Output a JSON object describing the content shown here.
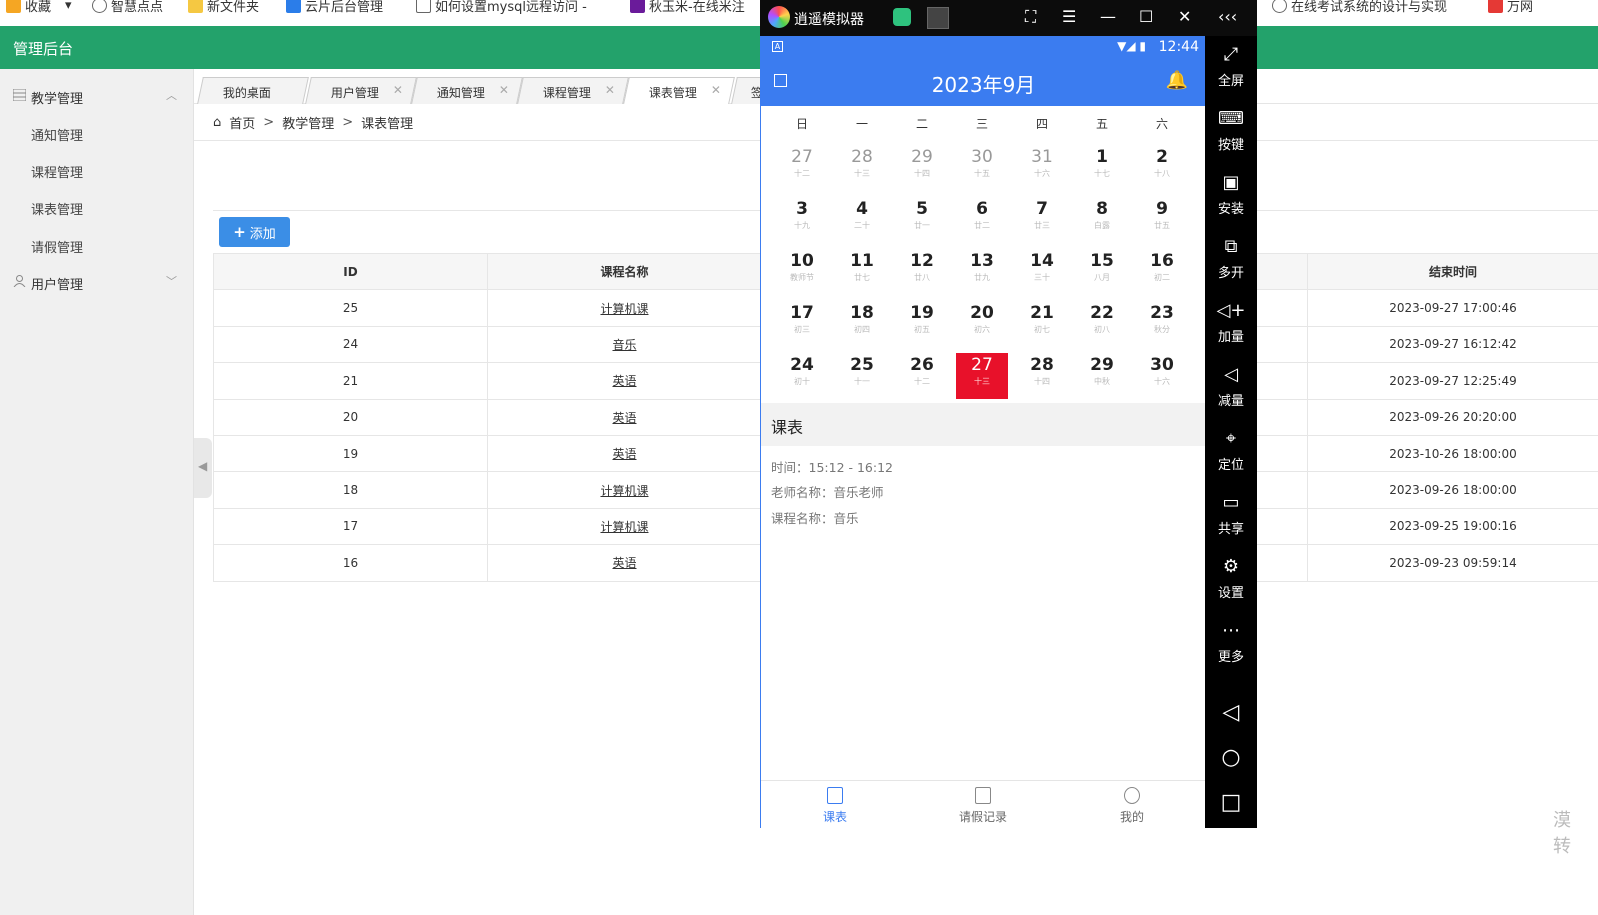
{
  "bookmarks": [
    {
      "label": "收藏",
      "color": "#f5a623"
    },
    {
      "label": "智慧点点",
      "color": "#555555"
    },
    {
      "label": "新文件夹",
      "color": "#f5c842"
    },
    {
      "label": "云片后台管理",
      "color": "#2b7de9"
    },
    {
      "label": "如何设置mysql远程访问 -",
      "color": "#555555"
    },
    {
      "label": "秋玉米-在线米注",
      "color": "#6a1b9a"
    },
    {
      "label": "在线考试系统的设计与实现",
      "color": "#555555"
    },
    {
      "label": "万网",
      "color": "#e53935"
    }
  ],
  "header": {
    "title": "管理后台",
    "accent": "#23a26b"
  },
  "sidebar": {
    "groups": [
      {
        "label": "教学管理",
        "icon": "grid-icon",
        "chevron": "︿"
      },
      {
        "label": "用户管理",
        "icon": "user-icon",
        "chevron": "﹀"
      }
    ],
    "items": [
      {
        "label": "通知管理"
      },
      {
        "label": "课程管理"
      },
      {
        "label": "课表管理"
      },
      {
        "label": "请假管理"
      }
    ]
  },
  "tabs": [
    {
      "label": "我的桌面",
      "closable": false
    },
    {
      "label": "用户管理",
      "closable": true
    },
    {
      "label": "通知管理",
      "closable": true
    },
    {
      "label": "课程管理",
      "closable": true
    },
    {
      "label": "课表管理",
      "closable": true,
      "active": true
    },
    {
      "label": "签",
      "closable": false
    }
  ],
  "breadcrumb": {
    "home": "首页",
    "sep": ">",
    "level1": "教学管理",
    "level2": "课表管理"
  },
  "toolbar": {
    "add_label": "添加"
  },
  "table": {
    "headers": {
      "id": "ID",
      "course": "课程名称",
      "end": "结束时间"
    },
    "rows": [
      {
        "id": "25",
        "course": "计算机课",
        "end": "2023-09-27 17:00:46"
      },
      {
        "id": "24",
        "course": "音乐",
        "end": "2023-09-27 16:12:42"
      },
      {
        "id": "21",
        "course": "英语",
        "end": "2023-09-27 12:25:49"
      },
      {
        "id": "20",
        "course": "英语",
        "end": "2023-09-26 20:20:00"
      },
      {
        "id": "19",
        "course": "英语",
        "end": "2023-10-26 18:00:00"
      },
      {
        "id": "18",
        "course": "计算机课",
        "end": "2023-09-26 18:00:00"
      },
      {
        "id": "17",
        "course": "计算机课",
        "end": "2023-09-25 19:00:16"
      },
      {
        "id": "16",
        "course": "英语",
        "end": "2023-09-23 09:59:14"
      }
    ]
  },
  "emulator": {
    "name": "逍遥模拟器",
    "controls": [
      "⛶",
      "☰",
      "—",
      "☐",
      "✕"
    ],
    "collapse": "‹‹‹",
    "status": {
      "time": "12:44",
      "signal": "▼◢ ▮"
    },
    "app": {
      "title": "2023年9月",
      "bell": "🔔"
    },
    "weekdays": [
      "日",
      "一",
      "二",
      "三",
      "四",
      "五",
      "六"
    ],
    "days": [
      {
        "n": "27",
        "l": "十二",
        "other": true
      },
      {
        "n": "28",
        "l": "十三",
        "other": true
      },
      {
        "n": "29",
        "l": "十四",
        "other": true
      },
      {
        "n": "30",
        "l": "十五",
        "other": true
      },
      {
        "n": "31",
        "l": "十六",
        "other": true
      },
      {
        "n": "1",
        "l": "十七"
      },
      {
        "n": "2",
        "l": "十八"
      },
      {
        "n": "3",
        "l": "十九"
      },
      {
        "n": "4",
        "l": "二十"
      },
      {
        "n": "5",
        "l": "廿一"
      },
      {
        "n": "6",
        "l": "廿二"
      },
      {
        "n": "7",
        "l": "廿三"
      },
      {
        "n": "8",
        "l": "白露"
      },
      {
        "n": "9",
        "l": "廿五"
      },
      {
        "n": "10",
        "l": "教师节"
      },
      {
        "n": "11",
        "l": "廿七"
      },
      {
        "n": "12",
        "l": "廿八"
      },
      {
        "n": "13",
        "l": "廿九"
      },
      {
        "n": "14",
        "l": "三十"
      },
      {
        "n": "15",
        "l": "八月"
      },
      {
        "n": "16",
        "l": "初二"
      },
      {
        "n": "17",
        "l": "初三"
      },
      {
        "n": "18",
        "l": "初四"
      },
      {
        "n": "19",
        "l": "初五"
      },
      {
        "n": "20",
        "l": "初六"
      },
      {
        "n": "21",
        "l": "初七"
      },
      {
        "n": "22",
        "l": "初八"
      },
      {
        "n": "23",
        "l": "秋分"
      },
      {
        "n": "24",
        "l": "初十"
      },
      {
        "n": "25",
        "l": "十一"
      },
      {
        "n": "26",
        "l": "十二"
      },
      {
        "n": "27",
        "l": "十三",
        "selected": true
      },
      {
        "n": "28",
        "l": "十四"
      },
      {
        "n": "29",
        "l": "中秋"
      },
      {
        "n": "30",
        "l": "十六"
      }
    ],
    "schedule": {
      "heading": "课表",
      "time": "时间：15:12 - 16:12",
      "teacher": "老师名称：音乐老师",
      "course": "课程名称：音乐"
    },
    "bottom_nav": [
      {
        "label": "课表",
        "active": true
      },
      {
        "label": "请假记录"
      },
      {
        "label": "我的"
      }
    ],
    "side_tools": [
      {
        "label": "全屏",
        "icon": "⤢"
      },
      {
        "label": "按键",
        "icon": "⌨"
      },
      {
        "label": "安装",
        "icon": "▣"
      },
      {
        "label": "多开",
        "icon": "⧉"
      },
      {
        "label": "加量",
        "icon": "◁+"
      },
      {
        "label": "减量",
        "icon": "◁"
      },
      {
        "label": "定位",
        "icon": "⌖"
      },
      {
        "label": "共享",
        "icon": "▭"
      },
      {
        "label": "设置",
        "icon": "⚙"
      },
      {
        "label": "更多",
        "icon": "⋯"
      }
    ],
    "android_nav": [
      "◁",
      "○",
      "□"
    ]
  },
  "edge_hint": "漠\n转"
}
